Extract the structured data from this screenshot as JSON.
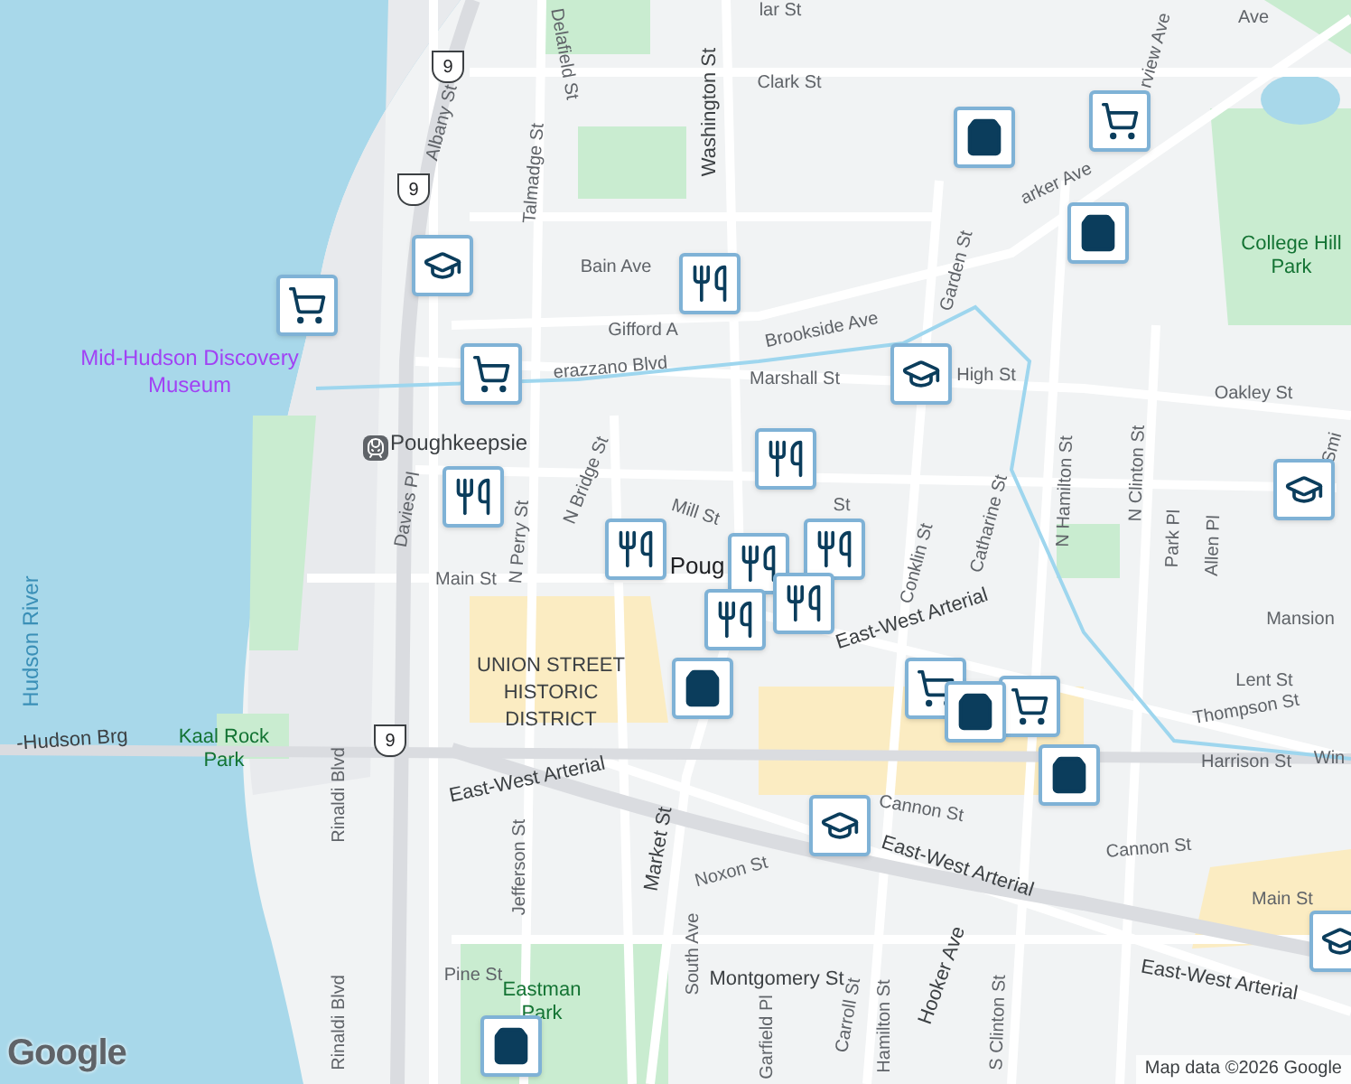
{
  "map": {
    "labels": [
      {
        "text": "lar St",
        "kind": "street"
      },
      {
        "text": "Ave",
        "kind": "street"
      },
      {
        "text": "rview Ave",
        "kind": "street"
      },
      {
        "text": "Delafield St",
        "kind": "street"
      },
      {
        "text": "Clark St",
        "kind": "street"
      },
      {
        "text": "Washington St",
        "kind": "major"
      },
      {
        "text": "Albany St",
        "kind": "street"
      },
      {
        "text": "Talmadge St",
        "kind": "street"
      },
      {
        "text": "arker Ave",
        "kind": "street"
      },
      {
        "text": "Garden St",
        "kind": "street"
      },
      {
        "text": "Bain Ave",
        "kind": "street"
      },
      {
        "text": "College Hill Park",
        "kind": "park"
      },
      {
        "text": "Gifford A",
        "kind": "street"
      },
      {
        "text": "Brookside Ave",
        "kind": "street"
      },
      {
        "text": "erazzano Blvd",
        "kind": "street"
      },
      {
        "text": "Marshall St",
        "kind": "street"
      },
      {
        "text": "High St",
        "kind": "street"
      },
      {
        "text": "Oakley St",
        "kind": "street"
      },
      {
        "text": "Smi",
        "kind": "street"
      },
      {
        "text": "Mid-Hudson Discovery Museum",
        "kind": "poi"
      },
      {
        "text": "Poughkeepsie",
        "kind": "station"
      },
      {
        "text": "Davies Pl",
        "kind": "street"
      },
      {
        "text": "N Perry St",
        "kind": "street"
      },
      {
        "text": "N Bridge St",
        "kind": "street"
      },
      {
        "text": "Mill St",
        "kind": "street"
      },
      {
        "text": "St",
        "kind": "street"
      },
      {
        "text": "Conklin St",
        "kind": "street"
      },
      {
        "text": "Catharine St",
        "kind": "street"
      },
      {
        "text": "N Hamilton St",
        "kind": "street"
      },
      {
        "text": "N Clinton St",
        "kind": "street"
      },
      {
        "text": "Park Pl",
        "kind": "street"
      },
      {
        "text": "Allen Pl",
        "kind": "street"
      },
      {
        "text": "Mansion",
        "kind": "street"
      },
      {
        "text": "Lent St",
        "kind": "street"
      },
      {
        "text": "Thompson St",
        "kind": "street"
      },
      {
        "text": "Harrison St",
        "kind": "street"
      },
      {
        "text": "Win",
        "kind": "street"
      },
      {
        "text": "Main St",
        "kind": "street"
      },
      {
        "text": "Poug",
        "kind": "city"
      },
      {
        "text": "UNION STREET HISTORIC DISTRICT",
        "kind": "district"
      },
      {
        "text": "Hudson River",
        "kind": "water"
      },
      {
        "text": "-Hudson Brg",
        "kind": "major"
      },
      {
        "text": "Kaal Rock Park",
        "kind": "park"
      },
      {
        "text": "Rinaldi Blvd",
        "kind": "street"
      },
      {
        "text": "Jefferson St",
        "kind": "street"
      },
      {
        "text": "East-West Arterial",
        "kind": "major"
      },
      {
        "text": "East-West Arterial",
        "kind": "major"
      },
      {
        "text": "East-West Arterial",
        "kind": "major"
      },
      {
        "text": "East-West Arterial",
        "kind": "major"
      },
      {
        "text": "Market St",
        "kind": "major"
      },
      {
        "text": "Noxon St",
        "kind": "street"
      },
      {
        "text": "Cannon St",
        "kind": "street"
      },
      {
        "text": "Cannon St",
        "kind": "street"
      },
      {
        "text": "Main St",
        "kind": "street"
      },
      {
        "text": "Pine St",
        "kind": "street"
      },
      {
        "text": "Eastman Park",
        "kind": "park"
      },
      {
        "text": "Montgomery St",
        "kind": "major"
      },
      {
        "text": "South Ave",
        "kind": "street"
      },
      {
        "text": "Garfield Pl",
        "kind": "street"
      },
      {
        "text": "Carroll St",
        "kind": "street"
      },
      {
        "text": "Hooker Ave",
        "kind": "major"
      },
      {
        "text": "Hamilton St",
        "kind": "street"
      },
      {
        "text": "S Clinton St",
        "kind": "street"
      },
      {
        "text": "Rinaldi Blvd",
        "kind": "street"
      }
    ],
    "shields": [
      {
        "text": "9"
      },
      {
        "text": "9"
      },
      {
        "text": "9"
      }
    ],
    "markers": [
      {
        "kind": "cart"
      },
      {
        "kind": "cart"
      },
      {
        "kind": "cart"
      },
      {
        "kind": "cart"
      },
      {
        "kind": "cart"
      },
      {
        "kind": "school"
      },
      {
        "kind": "school"
      },
      {
        "kind": "school"
      },
      {
        "kind": "school"
      },
      {
        "kind": "school"
      },
      {
        "kind": "food"
      },
      {
        "kind": "food"
      },
      {
        "kind": "food"
      },
      {
        "kind": "food"
      },
      {
        "kind": "food"
      },
      {
        "kind": "food"
      },
      {
        "kind": "food"
      },
      {
        "kind": "food"
      },
      {
        "kind": "bag"
      },
      {
        "kind": "bag"
      },
      {
        "kind": "bag"
      },
      {
        "kind": "bag"
      },
      {
        "kind": "bag"
      },
      {
        "kind": "bag"
      }
    ]
  },
  "footer": {
    "logo": "Google",
    "attribution": "Map data ©2026 Google"
  }
}
